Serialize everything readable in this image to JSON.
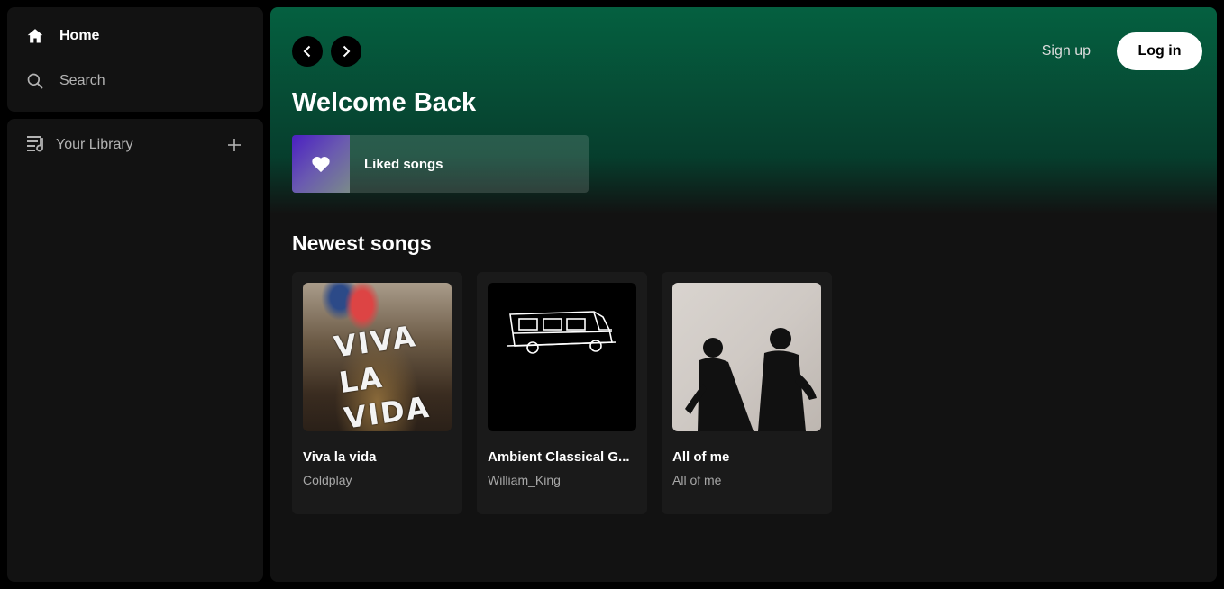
{
  "sidebar": {
    "home_label": "Home",
    "search_label": "Search",
    "library_label": "Your Library",
    "home_icon": "home-icon",
    "search_icon": "search-icon",
    "library_icon": "library-icon",
    "add_icon": "plus-icon"
  },
  "header": {
    "signup_label": "Sign up",
    "login_label": "Log in"
  },
  "main": {
    "welcome": "Welcome Back",
    "liked_label": "Liked songs",
    "section_title": "Newest songs",
    "songs": [
      {
        "title": "Viva la vida",
        "artist": "Coldplay",
        "cover_text": "VIVA LA VIDA"
      },
      {
        "title": "Ambient Classical G...",
        "artist": "William_King"
      },
      {
        "title": "All of me",
        "artist": "All of me"
      }
    ]
  },
  "colors": {
    "accent_green": "#056040",
    "background": "#121212",
    "panel": "#121212"
  }
}
